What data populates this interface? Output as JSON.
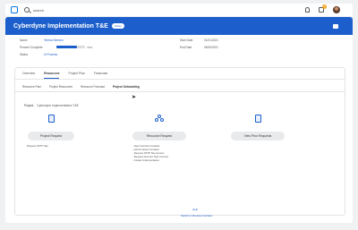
{
  "search": {
    "placeholder": "",
    "value": "search"
  },
  "notifications": {
    "inbox_count": "2"
  },
  "header": {
    "title": "Cyberdyne Implementation T&E",
    "badge": "Active"
  },
  "fields": {
    "name": {
      "label": "Name",
      "value": "Teresa Serrano"
    },
    "percent_complete": {
      "label": "Percent Complete",
      "value": "73%",
      "progress": 0.73
    },
    "status": {
      "label": "Status",
      "value": "In Process"
    },
    "start_date": {
      "label": "Start Date",
      "value": "01/01/2021"
    },
    "end_date": {
      "label": "End Date",
      "value": "06/30/2021"
    }
  },
  "tabs": [
    "Overview",
    "Resources",
    "Project Plan",
    "Financials"
  ],
  "active_tab": "Resources",
  "subtabs": [
    "Resource Plan",
    "Project Resources",
    "Resource Forecast",
    "Project Onboarding"
  ],
  "active_subtab": "Project Onboarding",
  "project": {
    "label": "Project",
    "value": "Cyberdyne Implementation T&E"
  },
  "columns": [
    {
      "button": "Project Request",
      "sub": "Request SFTP Site"
    },
    {
      "button": "Resource Request",
      "sub": "- New Contract Contacts\n- Add Contract Contacts\n- Request SFTP Site Access\n- Request Account Team Access\n- Create Implementation"
    },
    {
      "button": "View Prior Requests",
      "sub": ""
    }
  ],
  "links": {
    "help": "Help",
    "return": "Switch to Review Interface"
  },
  "colors": {
    "brand": "#1c5fcc",
    "badge": "#f5a623"
  }
}
